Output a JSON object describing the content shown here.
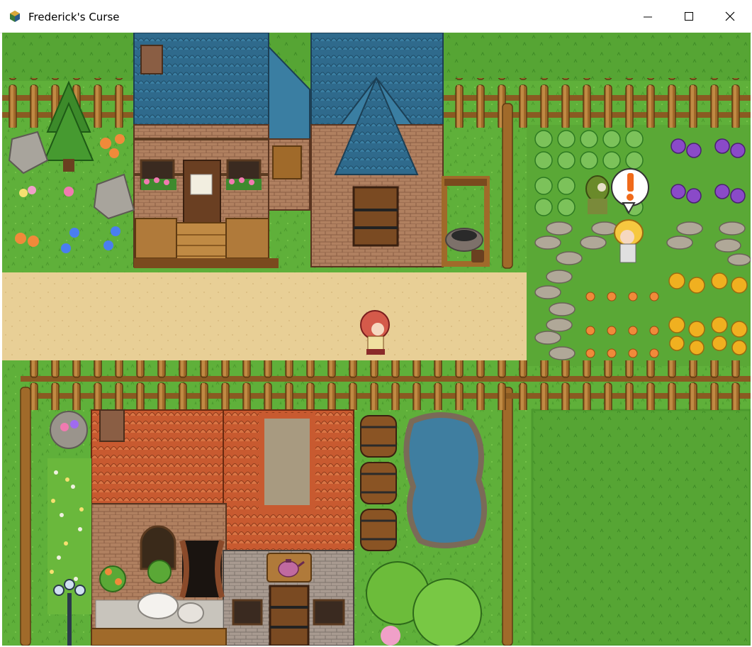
{
  "window": {
    "title": "Frederick's Curse",
    "app_icon": "rpg-maker-icon",
    "controls": [
      "minimize-icon",
      "maximize-icon",
      "close-icon"
    ]
  },
  "scene": {
    "type": "top-down 2D RPG village map",
    "colors": {
      "grass": "#5fb03a",
      "dirt_road": "#e8cf96",
      "fence_wood": "#a06a2a",
      "blue_roof": "#2f6a8c",
      "red_roof": "#d2683a",
      "pond_water": "#3f7ea0",
      "brick": "#b08060"
    },
    "characters": [
      {
        "name": "player-hero",
        "description": "red-haired hero"
      },
      {
        "name": "villager-farmer",
        "description": "blonde girl in farm"
      },
      {
        "name": "scarecrow",
        "description": "green hooded scarecrow"
      }
    ],
    "speech_balloon": {
      "symbol": "!",
      "icon": "exclamation-balloon-icon"
    },
    "shop_sign_icon": "teapot-sign-icon"
  }
}
